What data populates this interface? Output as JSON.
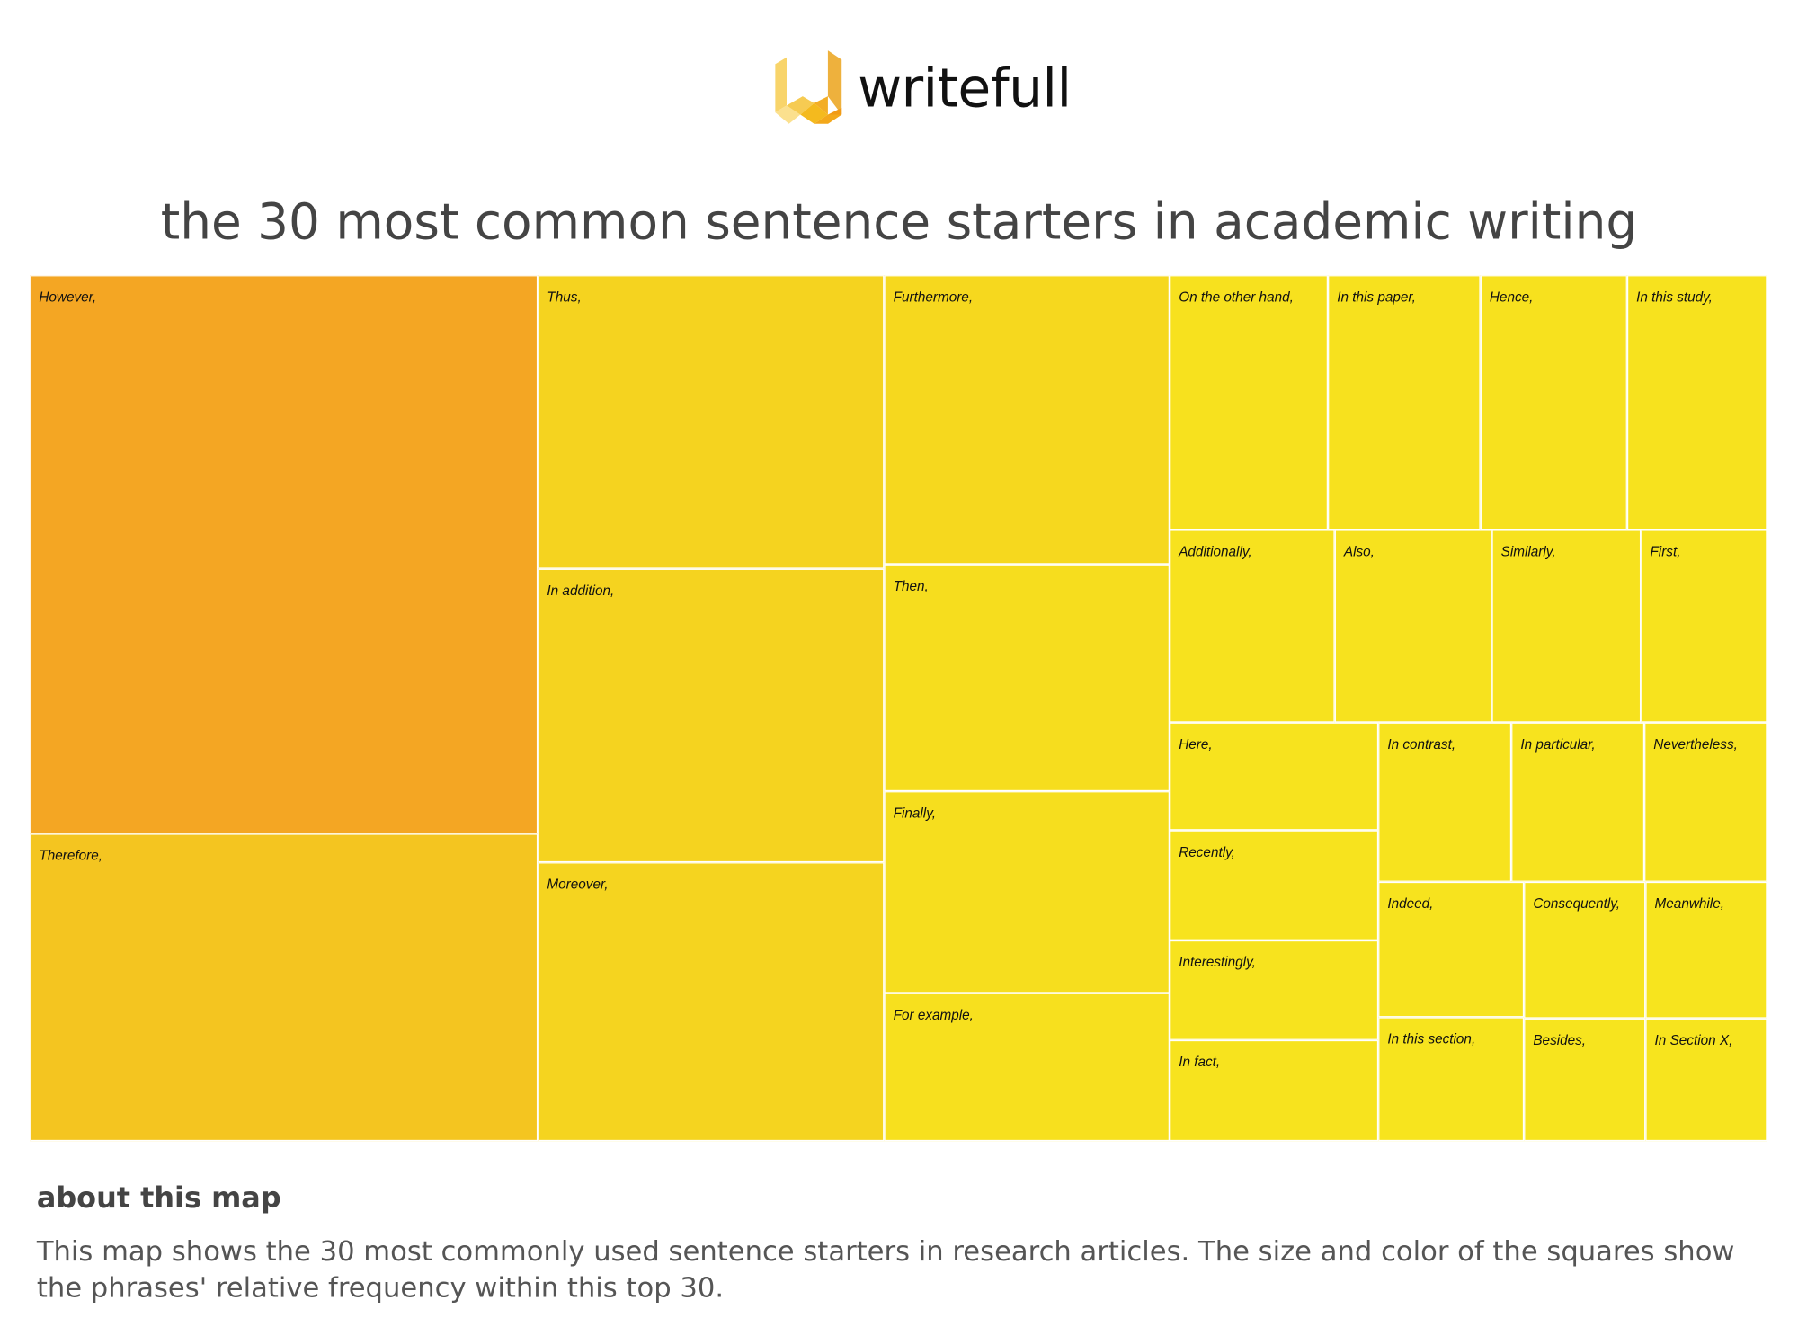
{
  "logo": {
    "text": "writefull"
  },
  "title": "the 30 most common sentence starters in academic writing",
  "about": {
    "heading": "about this map",
    "body": "This map shows the 30 most commonly used sentence starters in research articles. The size and color of the squares show the phrases' relative frequency within this top 30."
  },
  "chart_data": {
    "type": "treemap",
    "value_unit": "approximate share of top-30 area (%)",
    "items": [
      {
        "label": "However,",
        "value": 18.9,
        "color": "#F4A623"
      },
      {
        "label": "Therefore,",
        "value": 10.4,
        "color": "#F4C520"
      },
      {
        "label": "Thus,",
        "value": 6.8,
        "color": "#F5D31F"
      },
      {
        "label": "In addition,",
        "value": 6.8,
        "color": "#F5D31F"
      },
      {
        "label": "Moreover,",
        "value": 6.4,
        "color": "#F5D41F"
      },
      {
        "label": "Furthermore,",
        "value": 5.5,
        "color": "#F6D81E"
      },
      {
        "label": "Then,",
        "value": 4.3,
        "color": "#F6DD1E"
      },
      {
        "label": "Finally,",
        "value": 3.8,
        "color": "#F6DE1E"
      },
      {
        "label": "For example,",
        "value": 2.8,
        "color": "#F7E01E"
      },
      {
        "label": "On the other hand,",
        "value": 2.7,
        "color": "#F7E11E"
      },
      {
        "label": "In this paper,",
        "value": 2.6,
        "color": "#F7E11E"
      },
      {
        "label": "Hence,",
        "value": 2.5,
        "color": "#F7E11E"
      },
      {
        "label": "In this study,",
        "value": 2.4,
        "color": "#F7E21E"
      },
      {
        "label": "Additionally,",
        "value": 2.1,
        "color": "#F7E21E"
      },
      {
        "label": "Also,",
        "value": 2.0,
        "color": "#F7E21E"
      },
      {
        "label": "Similarly,",
        "value": 1.9,
        "color": "#F7E21E"
      },
      {
        "label": "First,",
        "value": 1.6,
        "color": "#F7E31E"
      },
      {
        "label": "Here,",
        "value": 1.5,
        "color": "#F7E31E"
      },
      {
        "label": "Recently,",
        "value": 1.5,
        "color": "#F7E31E"
      },
      {
        "label": "Interestingly,",
        "value": 1.4,
        "color": "#F7E31E"
      },
      {
        "label": "In fact,",
        "value": 1.4,
        "color": "#F7E31E"
      },
      {
        "label": "In contrast,",
        "value": 1.4,
        "color": "#F7E31E"
      },
      {
        "label": "In particular,",
        "value": 1.4,
        "color": "#F7E31E"
      },
      {
        "label": "Nevertheless,",
        "value": 1.3,
        "color": "#F7E31E"
      },
      {
        "label": "Indeed,",
        "value": 1.3,
        "color": "#F7E31E"
      },
      {
        "label": "In this section,",
        "value": 1.2,
        "color": "#F7E41E"
      },
      {
        "label": "Consequently,",
        "value": 1.1,
        "color": "#F7E41E"
      },
      {
        "label": "Besides,",
        "value": 1.0,
        "color": "#F7E41E"
      },
      {
        "label": "Meanwhile,",
        "value": 1.1,
        "color": "#F7E41E"
      },
      {
        "label": "In Section X,",
        "value": 1.0,
        "color": "#F7E41E"
      }
    ]
  }
}
